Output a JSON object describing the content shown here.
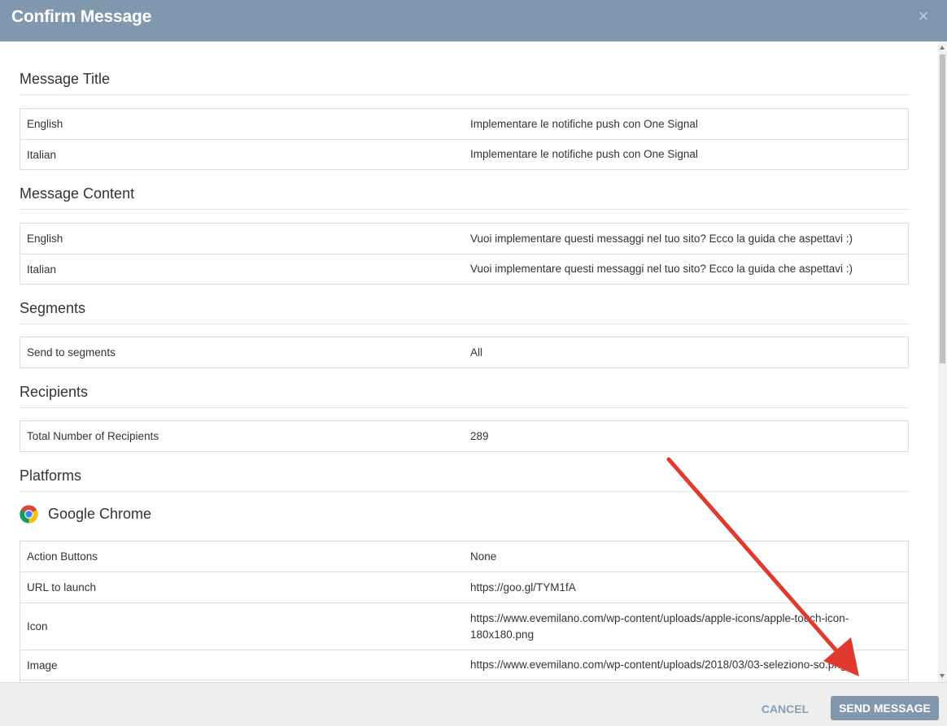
{
  "dialog": {
    "title": "Confirm Message",
    "close_glyph": "×"
  },
  "sections": {
    "message_title": {
      "title": "Message Title",
      "rows": [
        {
          "key": "English",
          "value": "Implementare le notifiche push con One Signal"
        },
        {
          "key": "Italian",
          "value": "Implementare le notifiche push con One Signal"
        }
      ]
    },
    "message_content": {
      "title": "Message Content",
      "rows": [
        {
          "key": "English",
          "value": "Vuoi implementare questi messaggi nel tuo sito? Ecco la guida che aspettavi :)"
        },
        {
          "key": "Italian",
          "value": "Vuoi implementare questi messaggi nel tuo sito? Ecco la guida che aspettavi :)"
        }
      ]
    },
    "segments": {
      "title": "Segments",
      "rows": [
        {
          "key": "Send to segments",
          "value": "All"
        }
      ]
    },
    "recipients": {
      "title": "Recipients",
      "rows": [
        {
          "key": "Total Number of Recipients",
          "value": "289"
        }
      ]
    },
    "platforms": {
      "title": "Platforms",
      "platform_name": "Google Chrome",
      "platform_icon": "chrome-icon",
      "rows": [
        {
          "key": "Action Buttons",
          "value": "None"
        },
        {
          "key": "URL to launch",
          "value": "https://goo.gl/TYM1fA"
        },
        {
          "key": "Icon",
          "value": "https://www.evemilano.com/wp-content/uploads/apple-icons/apple-touch-icon-180x180.png"
        },
        {
          "key": "Image",
          "value": "https://www.evemilano.com/wp-content/uploads/2018/03/03-seleziono-so.png"
        }
      ]
    }
  },
  "footer": {
    "cancel_label": "CANCEL",
    "send_label": "SEND MESSAGE"
  },
  "colors": {
    "header_bg": "#8097ad",
    "button_bg": "#8097ad",
    "annotation_arrow": "#e03a2f"
  }
}
